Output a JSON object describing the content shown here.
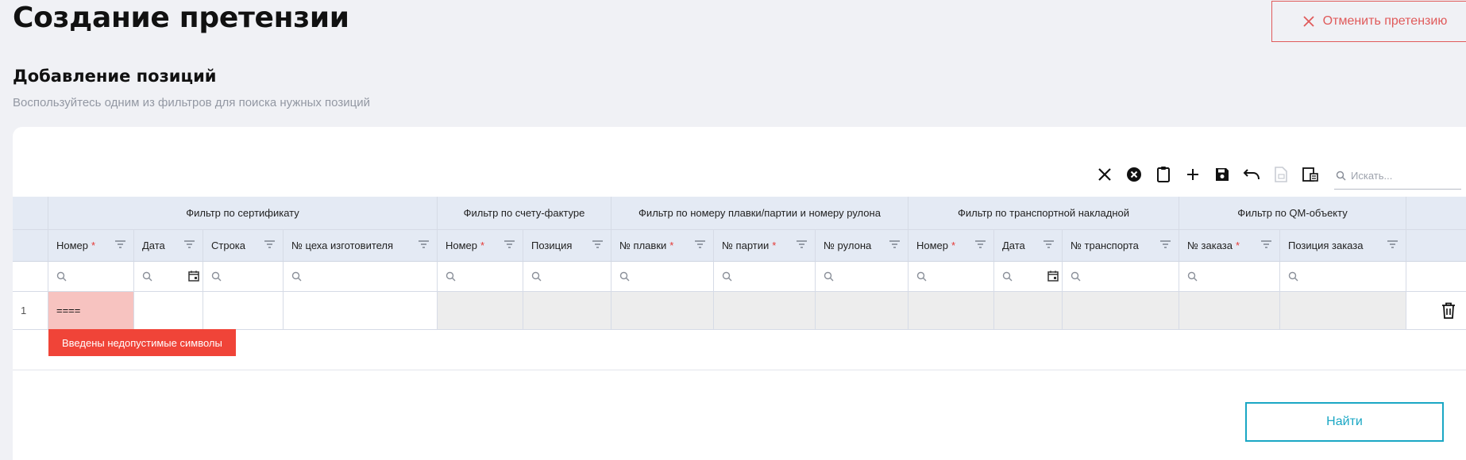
{
  "header": {
    "title": "Создание претензии",
    "cancel_label": "Отменить претензию"
  },
  "section": {
    "title": "Добавление позиций",
    "subtitle": "Воспользуйтесь одним из фильтров для поиска нужных позиций"
  },
  "toolbar": {
    "icons": [
      "close-icon",
      "cancel-circle-icon",
      "clipboard-icon",
      "plus-icon",
      "save-icon",
      "undo-icon",
      "export-file-icon",
      "columns-settings-icon"
    ],
    "search_placeholder": "Искать..."
  },
  "groups": [
    "Фильтр по сертификату",
    "Фильтр по счету-фактуре",
    "Фильтр по номеру плавки/партии и номеру рулона",
    "Фильтр по транспортной накладной",
    "Фильтр по QM-объекту"
  ],
  "columns": [
    {
      "label": "Номер",
      "required": true
    },
    {
      "label": "Дата",
      "required": false
    },
    {
      "label": "Строка",
      "required": false
    },
    {
      "label": "№ цеха изготовителя",
      "required": false
    },
    {
      "label": "Номер",
      "required": true
    },
    {
      "label": "Позиция",
      "required": false
    },
    {
      "label": "№ плавки",
      "required": true
    },
    {
      "label": "№ партии",
      "required": true
    },
    {
      "label": "№ рулона",
      "required": false
    },
    {
      "label": "Номер",
      "required": true
    },
    {
      "label": "Дата",
      "required": false
    },
    {
      "label": "№ транспорта",
      "required": false
    },
    {
      "label": "№ заказа",
      "required": true
    },
    {
      "label": "Позиция заказа",
      "required": false
    }
  ],
  "required_mark": "*",
  "row": {
    "index": "1",
    "cert_number_value": "====",
    "error_message": "Введены недопустимые символы"
  },
  "find_label": "Найти",
  "colors": {
    "accent": "#1aa7c4",
    "danger": "#e05a5a",
    "error_bg": "#f04438",
    "error_cell": "#f7c3c0",
    "header_bg": "#e4eaf4"
  }
}
